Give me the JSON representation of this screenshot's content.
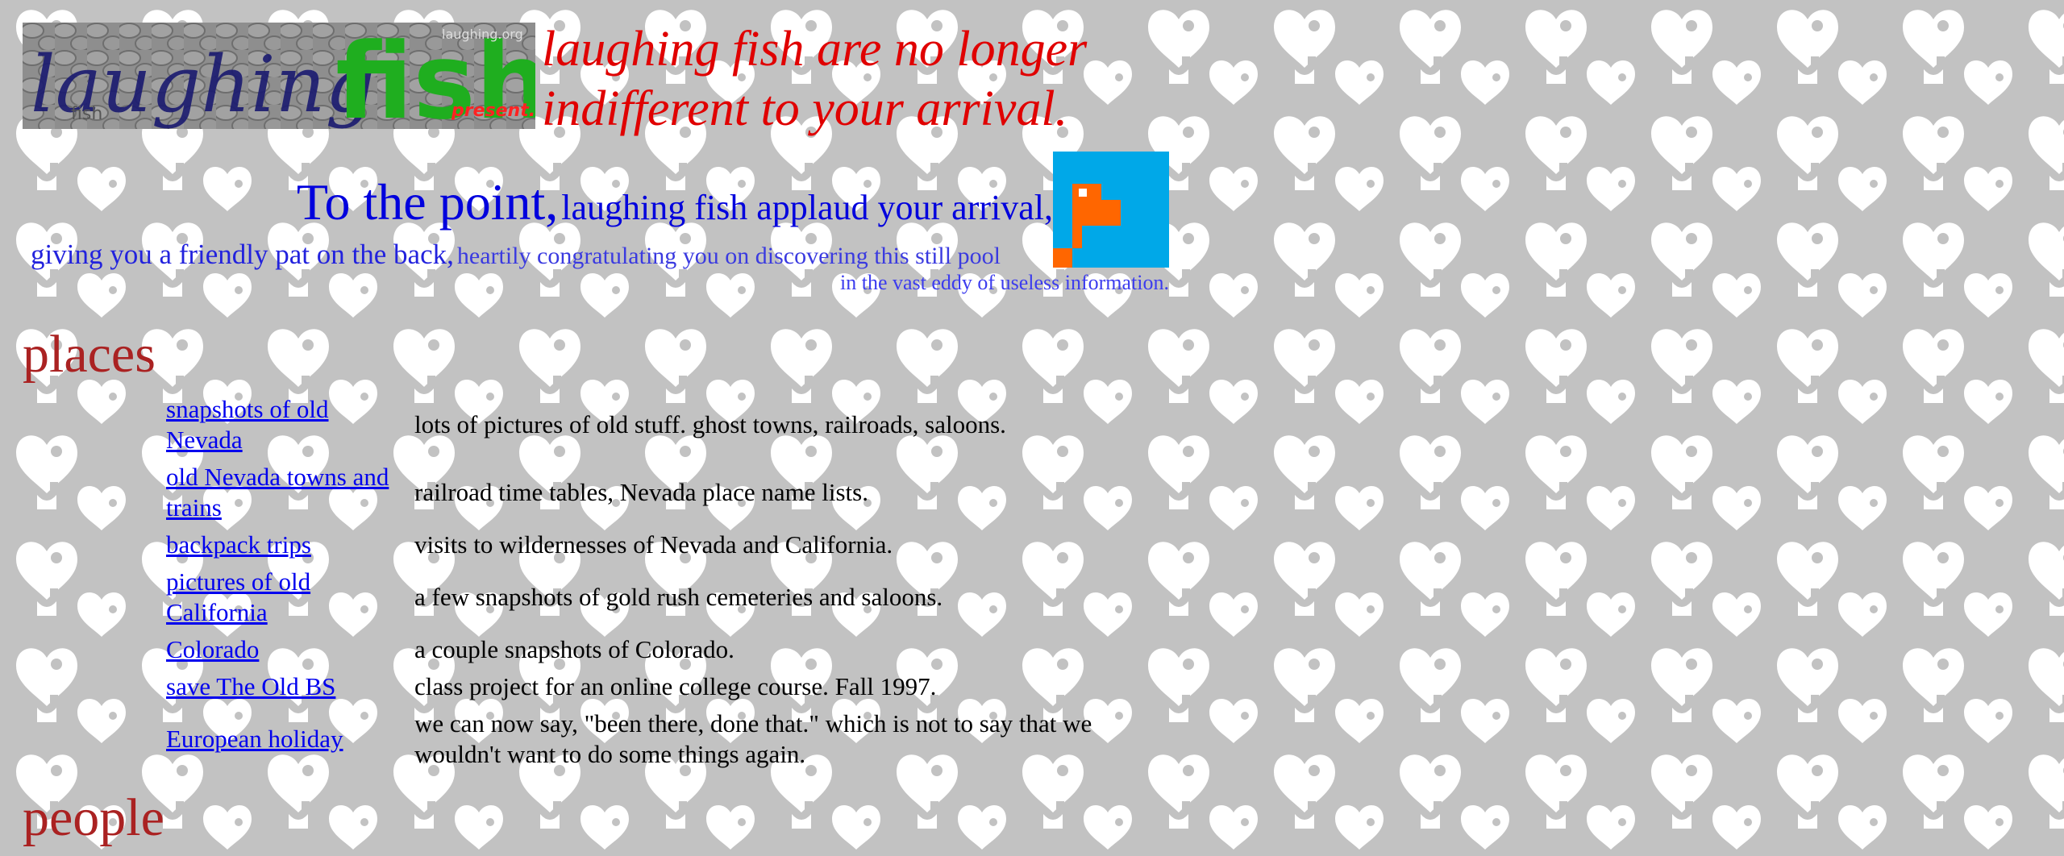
{
  "logo": {
    "text_main": "laughing",
    "text_green": "fish",
    "text_sub": "fish",
    "text_present": "present...",
    "text_watermark": "laughing.org"
  },
  "tagline": {
    "line1": "laughing fish are no longer",
    "line2": "indifferent to your arrival."
  },
  "intro": {
    "point_big": "To the point,",
    "point_mid": "laughing fish applaud your arrival,",
    "pat_a": "giving you a friendly pat on the back,",
    "pat_b": "heartily congratulating you on discovering this still pool",
    "eddy": "in the vast eddy of useless information."
  },
  "icons": {
    "fish": "pixel-fish-icon",
    "background": "heart-pattern"
  },
  "colors": {
    "tagline": "#e00000",
    "heading": "#aa2222",
    "link": "#0000ee",
    "intro": "#0000dd",
    "fish_bg": "#00a8e8",
    "fish_body": "#ff6600"
  },
  "places": {
    "heading": "places",
    "rows": [
      {
        "link": "snapshots of old Nevada",
        "desc": "lots of pictures of old stuff. ghost towns, railroads, saloons."
      },
      {
        "link": "old Nevada towns and trains",
        "desc": "railroad time tables, Nevada place name lists."
      },
      {
        "link": "backpack trips",
        "desc": "visits to wildernesses of Nevada and California."
      },
      {
        "link": "pictures of old California",
        "desc": "a few snapshots of gold rush cemeteries and saloons."
      },
      {
        "link": "Colorado",
        "desc": "a couple snapshots of Colorado."
      },
      {
        "link": "save The Old BS",
        "desc": "class project for an online college course. Fall 1997."
      },
      {
        "link": "European holiday",
        "desc": "we can now say, \"been there, done that.\" which is not to say that we wouldn't want to do some things again."
      }
    ]
  },
  "people": {
    "heading": "people"
  }
}
